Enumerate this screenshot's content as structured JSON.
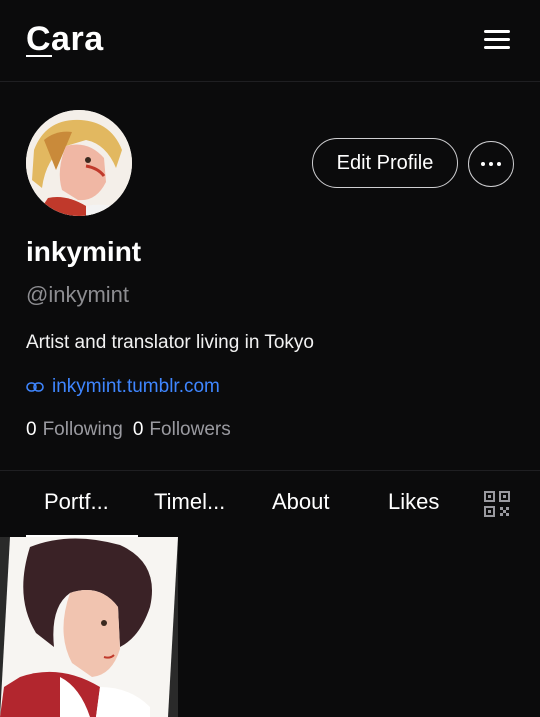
{
  "header": {
    "logo": "Cara",
    "menu_icon": "hamburger-menu-icon"
  },
  "profile": {
    "display_name": "inkymint",
    "handle": "@inkymint",
    "bio": "Artist and translator living in Tokyo",
    "link": "inkymint.tumblr.com",
    "following_count": "0",
    "following_label": "Following",
    "followers_count": "0",
    "followers_label": "Followers",
    "edit_button": "Edit Profile"
  },
  "tabs": [
    {
      "label": "Portf..."
    },
    {
      "label": "Timel..."
    },
    {
      "label": "About"
    },
    {
      "label": "Likes"
    }
  ],
  "colors": {
    "background": "#0b0b0c",
    "link": "#3f86ff",
    "muted": "#8d8d91"
  }
}
